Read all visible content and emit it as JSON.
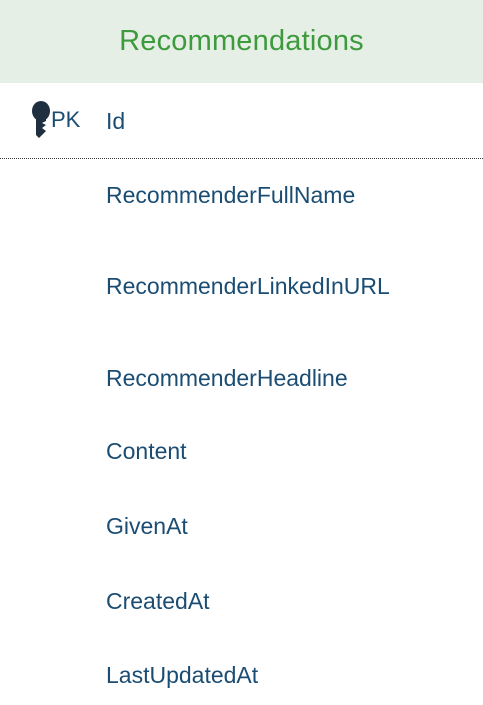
{
  "entity": {
    "title": "Recommendations",
    "primary_key": {
      "marker": "PK",
      "name": "Id"
    },
    "fields": [
      "RecommenderFullName",
      "RecommenderLinkedInURL",
      "RecommenderHeadline",
      "Content",
      "GivenAt",
      "CreatedAt",
      "LastUpdatedAt"
    ]
  },
  "colors": {
    "header_background": "#e6efe6",
    "title_text": "#3d9a3d",
    "field_text": "#1b4d73",
    "key_icon": "#1f2f3f"
  },
  "icons": {
    "primary_key": "key-icon"
  }
}
